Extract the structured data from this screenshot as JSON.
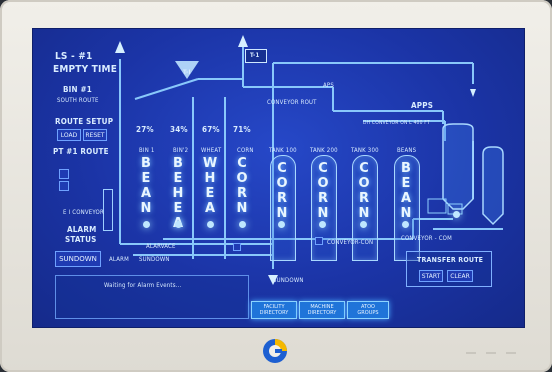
{
  "header": {
    "ls": "LS - #1",
    "empty_time": "EMPTY TIME",
    "bin": "BIN #1",
    "south_route": "SOUTH ROUTE",
    "route_setup": "ROUTE SETUP",
    "load": "LOAD",
    "reset": "RESET",
    "pt_route": "PT #1 ROUTE",
    "ei_conveyor": "E I CONVEYOR",
    "alarm_status_1": "ALARM",
    "alarm_status_2": "STATUS",
    "sundown_btn": "SUNDOWN",
    "alarm": "ALARM",
    "sundown": "SUNDOWN",
    "waiting": "Waiting for Alarm Events..."
  },
  "bins": [
    {
      "pct": "27%",
      "label": "BIN 1",
      "word": [
        "B",
        "E",
        "A",
        "N"
      ]
    },
    {
      "pct": "34%",
      "label": "BIN'2",
      "word": [
        "B",
        "E",
        "H",
        "E",
        "A"
      ]
    },
    {
      "pct": "67%",
      "label": "WHEAT",
      "word": [
        "W",
        "H",
        "E",
        "A"
      ]
    },
    {
      "pct": "71%",
      "label": "CORN",
      "word": [
        "C",
        "O",
        "R",
        "N"
      ]
    }
  ],
  "tanks": [
    {
      "label": "TANK 100",
      "word": [
        "C",
        "O",
        "R",
        "N"
      ]
    },
    {
      "label": "TANK 200",
      "word": [
        "C",
        "O",
        "R",
        "N"
      ]
    },
    {
      "label": "TANK 300",
      "word": [
        "C",
        "O",
        "R",
        "N"
      ]
    },
    {
      "label": "BEANS",
      "word": [
        "B",
        "E",
        "A",
        "N"
      ]
    }
  ],
  "flow": {
    "t1_top": "T-1",
    "t1_hopper": "T-I",
    "conveyor_rout": "CONVEYOR ROUT",
    "aps": "APS",
    "apps": "APPS",
    "dh_conveyor": "DH CONVEYOR ON L 400 FT",
    "alarvace": "ALARVACE",
    "conveyor_con": "CONVEYOR-CON",
    "conveyor_com": "CONVEYOR - COM",
    "sundown2": "SUNDOWN"
  },
  "transfer": {
    "title": "TRANSFER ROUTE",
    "start": "START",
    "clear": "CLEAR"
  },
  "bottom_buttons": {
    "b1": "FACILITY\nDIRECTORY",
    "b2": "MACHINE\nDIRECTORY",
    "b3": "ATOO\nGROUPS"
  },
  "colors": {
    "screen_bg": "#1b34a6",
    "line": "#8fd0ff",
    "accent": "#1f74d9"
  }
}
